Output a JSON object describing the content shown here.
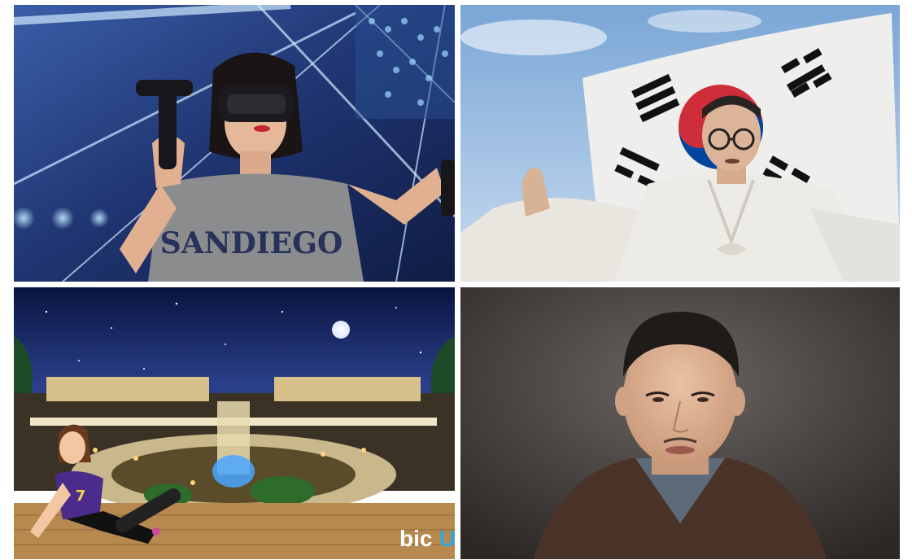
{
  "photos": [
    {
      "id": "vr",
      "shirt_text": "SANDIEGO"
    },
    {
      "id": "flag"
    },
    {
      "id": "mall",
      "jersey_number": "7",
      "logo": {
        "text_main": "bic",
        "text_accent": "U",
        "accent_color": "#2fa8e0"
      }
    },
    {
      "id": "face"
    }
  ]
}
